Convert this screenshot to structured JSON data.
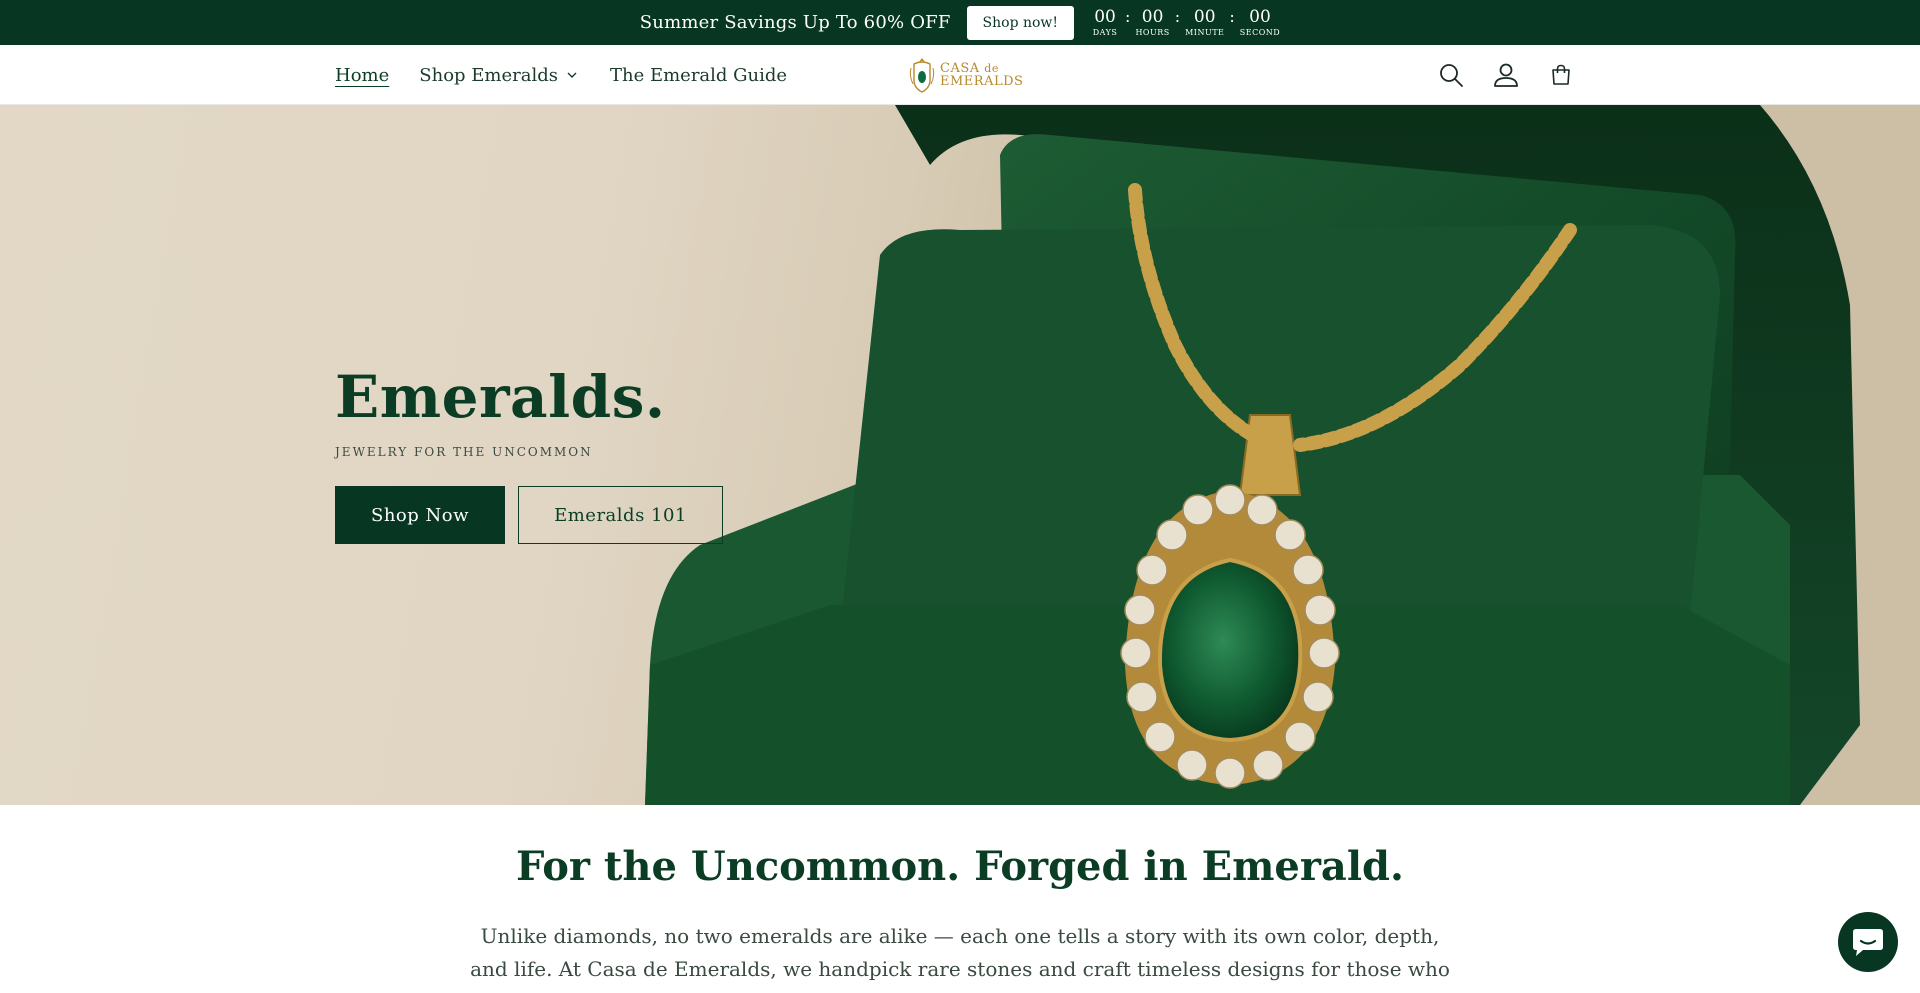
{
  "announcement": {
    "text": "Summer Savings Up To 60% OFF",
    "button_label": "Shop now!",
    "countdown": [
      {
        "value": "00",
        "label": "DAYS"
      },
      {
        "value": "00",
        "label": "HOURS"
      },
      {
        "value": "00",
        "label": "MINUTE"
      },
      {
        "value": "00",
        "label": "SECOND"
      }
    ],
    "separator": ":"
  },
  "nav": {
    "items": [
      {
        "label": "Home"
      },
      {
        "label": "Shop Emeralds"
      },
      {
        "label": "The Emerald Guide"
      }
    ]
  },
  "logo": {
    "line1": "CASA",
    "de": "de",
    "line2": "EMERALDS"
  },
  "header_icons": [
    "search-icon",
    "account-icon",
    "cart-icon"
  ],
  "hero": {
    "title": "Emeralds.",
    "subtitle": "JEWELRY FOR THE UNCOMMON",
    "primary_button": "Shop Now",
    "secondary_button": "Emeralds 101"
  },
  "intro": {
    "heading": "For the Uncommon. Forged in Emerald.",
    "body": "Unlike diamonds, no two emeralds are alike — each one tells a story with its own color, depth, and life. At Casa de Emeralds, we handpick rare stones and craft timeless designs for those who lead, love,"
  },
  "colors": {
    "brand_green": "#073622",
    "gold": "#b88a2e",
    "hero_beige": "#e1d6c4"
  }
}
